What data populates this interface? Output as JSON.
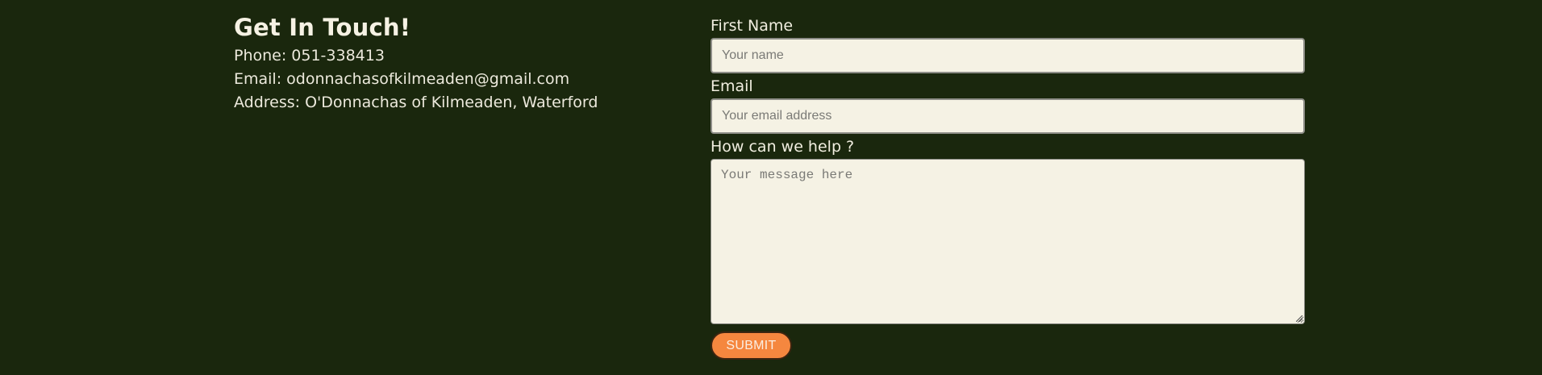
{
  "contact": {
    "title": "Get In Touch!",
    "phone": "Phone: 051-338413",
    "email": "Email: odonnachasofkilmeaden@gmail.com",
    "address": "Address: O'Donnachas of Kilmeaden, Waterford"
  },
  "form": {
    "name_label": "First Name",
    "name_placeholder": "Your name",
    "email_label": "Email",
    "email_placeholder": "Your email address",
    "message_label": "How can we help ?",
    "message_placeholder": "Your message here",
    "submit_label": "SUBMIT"
  },
  "colors": {
    "background": "#1a270d",
    "input_background": "#f5f2e4",
    "submit_button": "#f5873f",
    "text": "#f4f1e3"
  }
}
